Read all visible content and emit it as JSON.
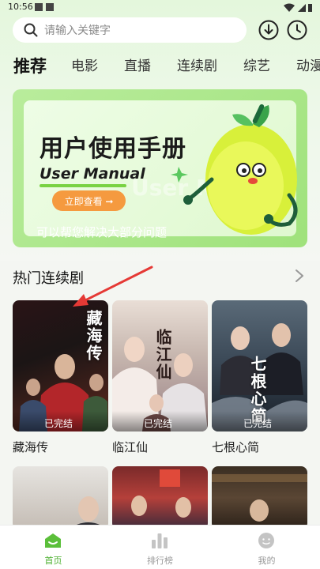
{
  "status_bar": {
    "time": "10:56"
  },
  "search": {
    "placeholder": "请输入关键字"
  },
  "tabs": [
    {
      "label": "推荐",
      "active": true
    },
    {
      "label": "电影",
      "active": false
    },
    {
      "label": "直播",
      "active": false
    },
    {
      "label": "连续剧",
      "active": false
    },
    {
      "label": "综艺",
      "active": false
    },
    {
      "label": "动漫",
      "active": false
    }
  ],
  "banner": {
    "title": "用户使用手册",
    "subtitle": "User Manual",
    "button_label": "立即查看 ➞",
    "watermark": "User Manual",
    "caption": "可以帮您解决大部分问题"
  },
  "section": {
    "title": "热门连续剧"
  },
  "cards": [
    {
      "title": "藏海传",
      "badge": "已完结",
      "poster_art": "藏海传"
    },
    {
      "title": "临江仙",
      "badge": "已完结",
      "poster_art": "临江仙"
    },
    {
      "title": "七根心简",
      "badge": "已完结",
      "poster_art": "七根心简"
    }
  ],
  "bottom_nav": [
    {
      "label": "首页",
      "icon": "home-icon",
      "active": true
    },
    {
      "label": "排行榜",
      "icon": "ranking-icon",
      "active": false
    },
    {
      "label": "我的",
      "icon": "profile-icon",
      "active": false
    }
  ],
  "colors": {
    "accent": "#4cb02f",
    "banner_button": "#f59a3f",
    "annotation_arrow": "#e53935"
  }
}
